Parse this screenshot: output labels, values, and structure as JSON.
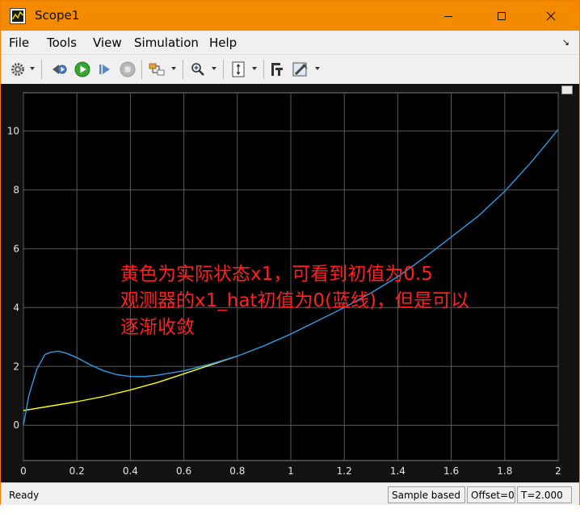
{
  "window": {
    "title": "Scope1"
  },
  "menu": {
    "items": [
      "File",
      "Tools",
      "View",
      "Simulation",
      "Help"
    ],
    "pin_glyph": "↘"
  },
  "toolbar": {
    "buttons": [
      "gear-icon",
      "step-back-icon",
      "run-icon",
      "step-forward-icon",
      "stop-icon",
      "highlight-icon",
      "zoom-icon",
      "fit-to-view-icon",
      "cursor-measure-icon",
      "style-icon"
    ]
  },
  "annotation": {
    "line1": "黄色为实际状态x1，可看到初值为0.5",
    "line2": "观测器的x1_hat初值为0(蓝线)，但是可以",
    "line3": "逐渐收敛"
  },
  "status": {
    "ready": "Ready",
    "sample": "Sample based",
    "offset": "Offset=0",
    "time": "T=2.000"
  },
  "colors": {
    "title_bar": "#f48a00",
    "plot_bg": "#000000",
    "grid": "#5a5a5a",
    "series_blue": "#2e9be6",
    "series_yellow": "#ffff00",
    "annotation": "#ff2020"
  },
  "chart_data": {
    "type": "line",
    "xlim": [
      0,
      2
    ],
    "ylim": [
      -1.2,
      11.3
    ],
    "x_ticks": [
      "0",
      "0.2",
      "0.4",
      "0.6",
      "0.8",
      "1",
      "1.2",
      "1.4",
      "1.6",
      "1.8",
      "2"
    ],
    "y_ticks": [
      "0",
      "2",
      "4",
      "6",
      "8",
      "10"
    ],
    "grid": true,
    "series": [
      {
        "color": "#ffff00",
        "x": [
          0,
          0.1,
          0.2,
          0.3,
          0.4,
          0.5,
          0.6,
          0.7,
          0.8
        ],
        "values": [
          0.5,
          0.65,
          0.8,
          0.98,
          1.2,
          1.45,
          1.75,
          2.05,
          2.35
        ]
      },
      {
        "color": "#2e9be6",
        "x": [
          0,
          0.02,
          0.05,
          0.08,
          0.1,
          0.13,
          0.16,
          0.2,
          0.25,
          0.3,
          0.35,
          0.4,
          0.45,
          0.5,
          0.6,
          0.7,
          0.8,
          0.9,
          1.0,
          1.1,
          1.2,
          1.3,
          1.4,
          1.5,
          1.6,
          1.7,
          1.8,
          1.9,
          2.0
        ],
        "values": [
          0.0,
          1.0,
          1.9,
          2.4,
          2.48,
          2.52,
          2.45,
          2.3,
          2.05,
          1.85,
          1.72,
          1.66,
          1.65,
          1.7,
          1.85,
          2.08,
          2.35,
          2.7,
          3.1,
          3.55,
          4.0,
          4.5,
          5.05,
          5.7,
          6.4,
          7.1,
          7.95,
          8.95,
          10.05
        ]
      }
    ]
  }
}
